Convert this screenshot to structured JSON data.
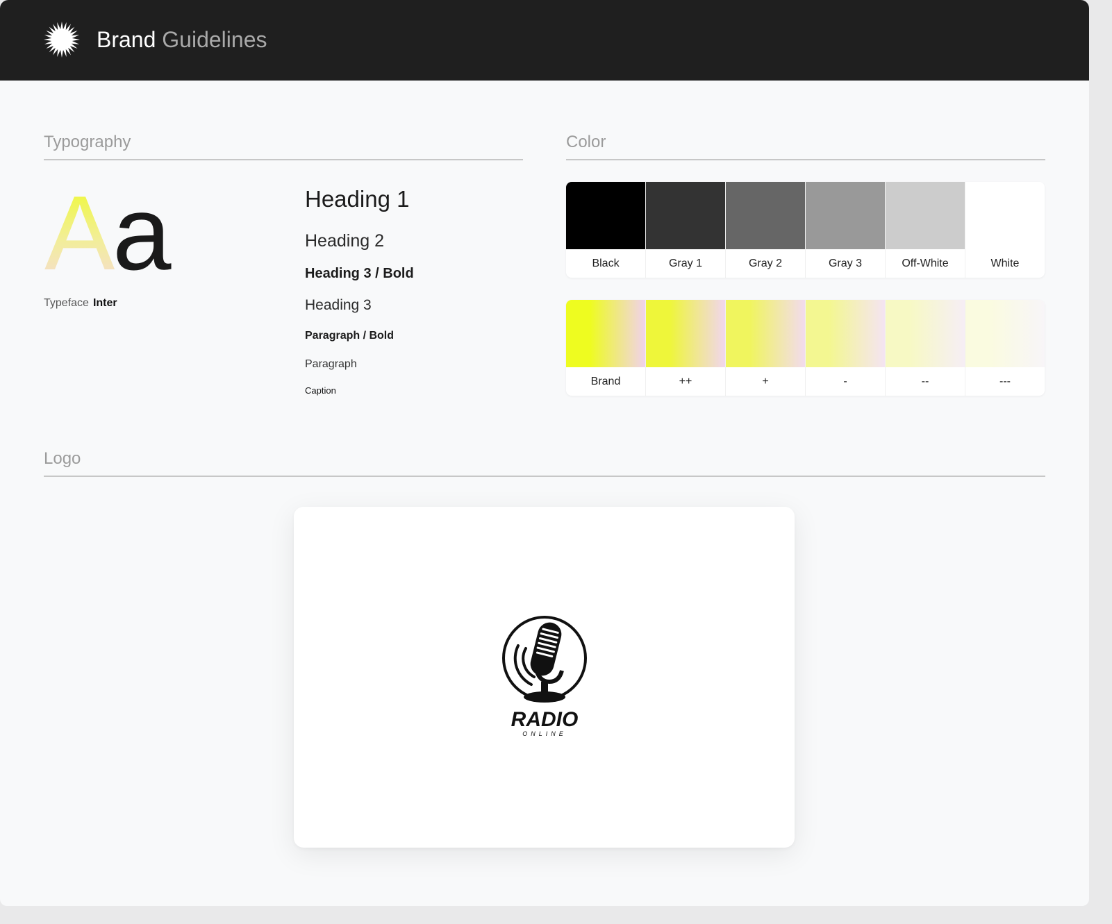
{
  "header": {
    "title_primary": "Brand",
    "title_secondary": "Guidelines",
    "logo_icon": "starburst-icon"
  },
  "typography": {
    "section_title": "Typography",
    "specimen": {
      "upper": "A",
      "lower": "a"
    },
    "typeface_label": "Typeface",
    "typeface_name": "Inter",
    "samples": {
      "heading1": "Heading 1",
      "heading2": "Heading 2",
      "heading3_bold": "Heading 3 / Bold",
      "heading3": "Heading 3",
      "paragraph_bold": "Paragraph / Bold",
      "paragraph": "Paragraph",
      "caption": "Caption"
    }
  },
  "color": {
    "section_title": "Color",
    "neutrals": [
      {
        "label": "Black",
        "hex": "#000000"
      },
      {
        "label": "Gray 1",
        "hex": "#333333"
      },
      {
        "label": "Gray 2",
        "hex": "#666666"
      },
      {
        "label": "Gray 3",
        "hex": "#999999"
      },
      {
        "label": "Off-White",
        "hex": "#cccccc"
      },
      {
        "label": "White",
        "hex": "#ffffff"
      }
    ],
    "brand": [
      {
        "label": "Brand",
        "from": "#eefc20",
        "to": "#f0d2ec"
      },
      {
        "label": "++",
        "from": "#eef63a",
        "to": "#f1d6ee"
      },
      {
        "label": "+",
        "from": "#f0f55e",
        "to": "#f2dbee"
      },
      {
        "label": "-",
        "from": "#f3f791",
        "to": "#f4e4f2"
      },
      {
        "label": "--",
        "from": "#f7f9c4",
        "to": "#f6eef5"
      },
      {
        "label": "---",
        "from": "#fafbe0",
        "to": "#f8f5f8"
      }
    ]
  },
  "logo": {
    "section_title": "Logo",
    "wordmark": "RADIO",
    "tagline": "ONLINE",
    "icon": "microphone-icon"
  }
}
